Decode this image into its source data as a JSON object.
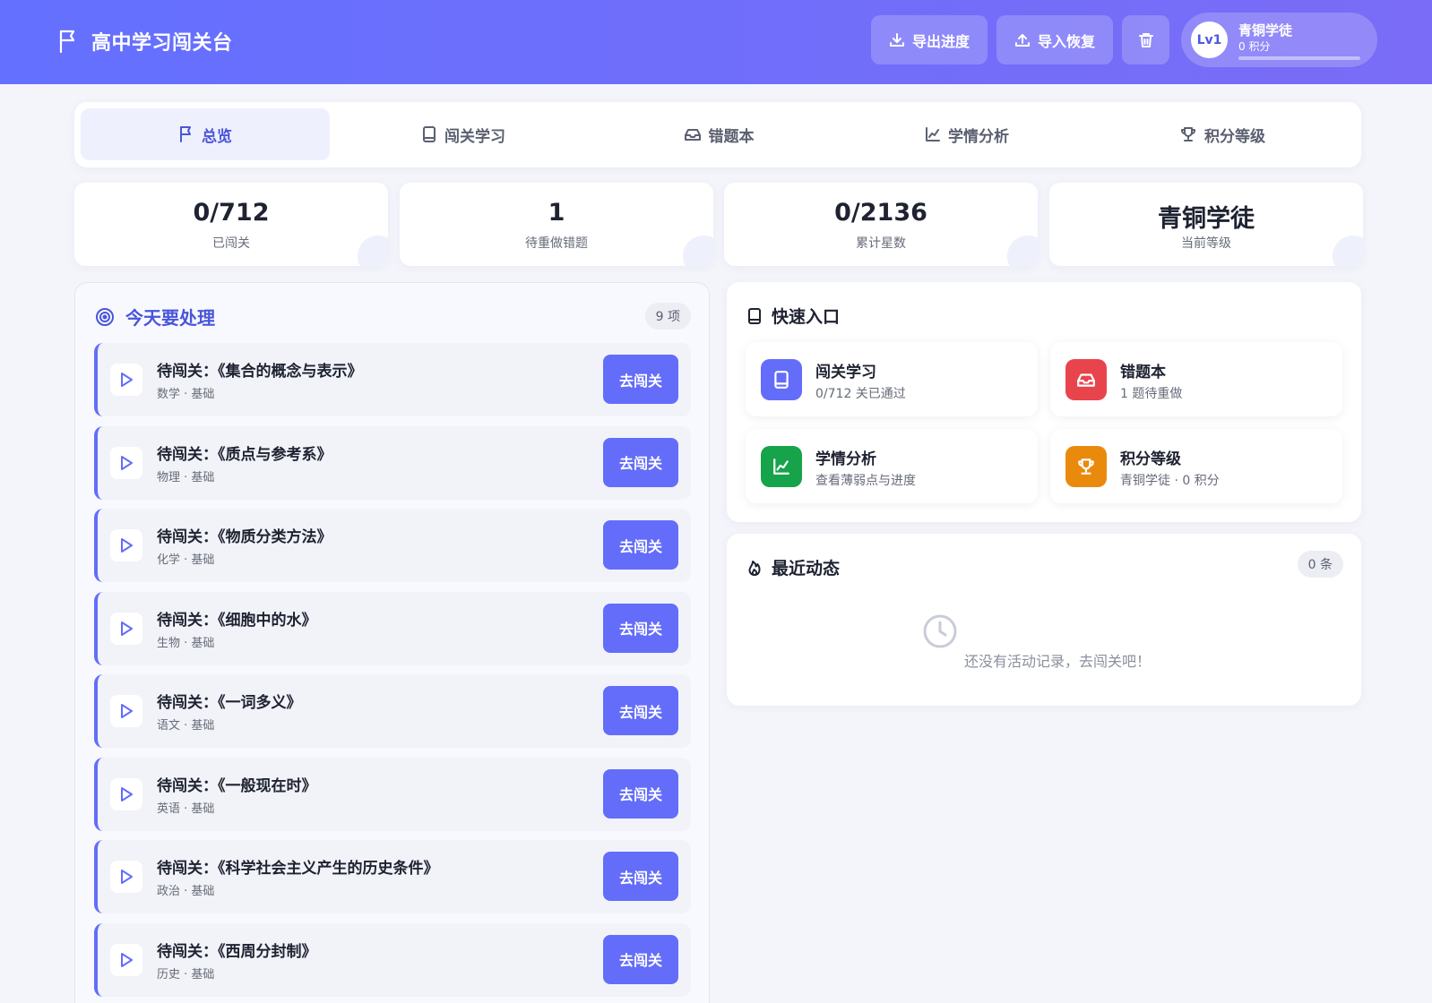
{
  "header": {
    "title": "高中学习闯关台",
    "export_label": "导出进度",
    "import_label": "导入恢复",
    "level_badge": "Lv1",
    "user_title": "青铜学徒",
    "points": "0 积分",
    "progress_fraction": 0
  },
  "tabs": [
    {
      "label": "总览",
      "icon": "flag-icon",
      "active": true
    },
    {
      "label": "闯关学习",
      "icon": "book-icon",
      "active": false
    },
    {
      "label": "错题本",
      "icon": "inbox-icon",
      "active": false
    },
    {
      "label": "学情分析",
      "icon": "chart-icon",
      "active": false
    },
    {
      "label": "积分等级",
      "icon": "trophy-icon",
      "active": false
    }
  ],
  "stats": [
    {
      "value": "0/712",
      "label": "已闯关"
    },
    {
      "value": "1",
      "label": "待重做错题"
    },
    {
      "value": "0/2136",
      "label": "累计星数"
    },
    {
      "value": "青铜学徒",
      "label": "当前等级"
    }
  ],
  "today": {
    "title": "今天要处理",
    "count": "9 项",
    "action_label": "去闯关",
    "tasks": [
      {
        "title": "待闯关：《集合的概念与表示》",
        "subtitle": "数学 · 基础"
      },
      {
        "title": "待闯关：《质点与参考系》",
        "subtitle": "物理 · 基础"
      },
      {
        "title": "待闯关：《物质分类方法》",
        "subtitle": "化学 · 基础"
      },
      {
        "title": "待闯关：《细胞中的水》",
        "subtitle": "生物 · 基础"
      },
      {
        "title": "待闯关：《一词多义》",
        "subtitle": "语文 · 基础"
      },
      {
        "title": "待闯关：《一般现在时》",
        "subtitle": "英语 · 基础"
      },
      {
        "title": "待闯关：《科学社会主义产生的历史条件》",
        "subtitle": "政治 · 基础"
      },
      {
        "title": "待闯关：《西周分封制》",
        "subtitle": "历史 · 基础"
      }
    ]
  },
  "quick": {
    "title": "快速入口",
    "items": [
      {
        "title": "闯关学习",
        "subtitle": "0/712 关已通过",
        "color": "#636dfa",
        "icon": "book-icon"
      },
      {
        "title": "错题本",
        "subtitle": "1 题待重做",
        "color": "#e8444c",
        "icon": "inbox-icon"
      },
      {
        "title": "学情分析",
        "subtitle": "查看薄弱点与进度",
        "color": "#16a34a",
        "icon": "chart-icon"
      },
      {
        "title": "积分等级",
        "subtitle": "青铜学徒 · 0 积分",
        "color": "#ea8a0c",
        "icon": "trophy-icon"
      }
    ]
  },
  "recent": {
    "title": "最近动态",
    "count": "0 条",
    "empty_text": "还没有活动记录，去闯关吧！"
  },
  "colors": {
    "accent": "#636dfa",
    "accent_text": "#4a55d9"
  }
}
